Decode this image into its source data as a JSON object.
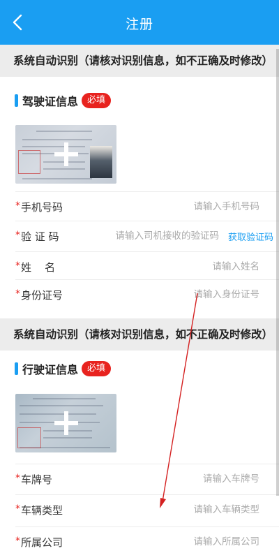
{
  "header": {
    "title": "注册"
  },
  "sections": {
    "auto_recognize_1": "系统自动识别（请核对识别信息，如不正确及时修改）",
    "auto_recognize_2": "系统自动识别（请核对识别信息，如不正确及时修改）"
  },
  "driver_license": {
    "title": "驾驶证信息",
    "badge": "必填"
  },
  "driver_fields": {
    "phone": {
      "label": "手机号码",
      "placeholder": "请输入手机号码"
    },
    "code": {
      "label": "验 证 码",
      "placeholder": "请输入司机接收的验证码",
      "button": "获取验证码"
    },
    "name": {
      "label": "姓    名",
      "placeholder": "请输入姓名"
    },
    "id_number": {
      "label": "身份证号",
      "placeholder": "请输入身份证号"
    }
  },
  "vehicle_license": {
    "title": "行驶证信息",
    "badge": "必填"
  },
  "vehicle_fields": {
    "plate": {
      "label": "车牌号",
      "placeholder": "请输入车牌号"
    },
    "vehicle_type": {
      "label": "车辆类型",
      "placeholder": "请输入车辆类型"
    },
    "company": {
      "label": "所属公司",
      "placeholder": "请输入所属公司"
    }
  },
  "required_mark": "*",
  "colors": {
    "primary": "#1a9ef2",
    "badge": "#e8231f",
    "section_bg": "#ececec",
    "annotation_arrow": "#d42020"
  },
  "icons": {
    "back": "chevron-left-icon",
    "upload": "plus-icon",
    "annotation": "arrow-icon"
  }
}
